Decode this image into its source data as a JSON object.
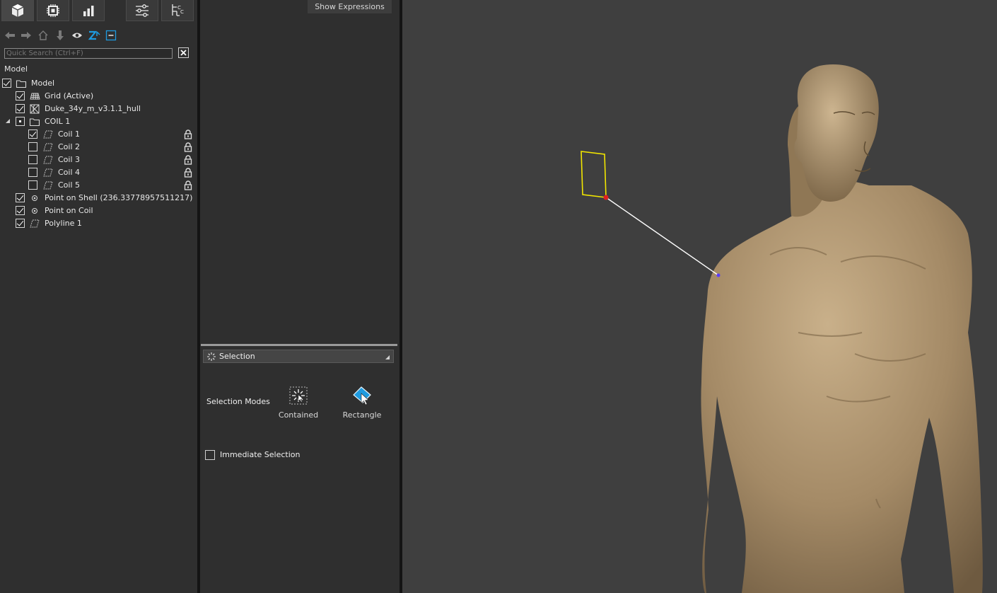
{
  "toolbar": {
    "tabs": [
      {
        "icon": "model-cube-icon",
        "active": true
      },
      {
        "icon": "chip-icon",
        "active": false
      },
      {
        "icon": "bar-chart-icon",
        "active": false
      },
      {
        "icon": "sliders-icon",
        "active": false
      },
      {
        "icon": "hierarchy-icon",
        "active": false
      }
    ],
    "tools": [
      "back-arrow-icon",
      "forward-arrow-icon",
      "home-icon",
      "down-arrow-icon",
      "eye-icon",
      "z-sort-icon",
      "collapse-icon"
    ]
  },
  "search": {
    "placeholder": "Quick Search (Ctrl+F)",
    "value": ""
  },
  "tree": {
    "header": "Model",
    "items": [
      {
        "label": "Model",
        "checked": true,
        "icon": "folder-icon",
        "level": 0
      },
      {
        "label": "Grid (Active)",
        "checked": true,
        "icon": "grid-icon",
        "level": 1
      },
      {
        "label": "Duke_34y_m_v3.1.1_hull",
        "checked": true,
        "icon": "mesh-icon",
        "level": 1
      },
      {
        "label": "COIL 1",
        "checked": "partial",
        "icon": "folder-icon",
        "level": 1,
        "expanded": true
      },
      {
        "label": "Coil 1",
        "checked": true,
        "icon": "polyline-icon",
        "level": 2,
        "locked": true
      },
      {
        "label": "Coil 2",
        "checked": false,
        "icon": "polyline-icon",
        "level": 2,
        "locked": true
      },
      {
        "label": "Coil 3",
        "checked": false,
        "icon": "polyline-icon",
        "level": 2,
        "locked": true
      },
      {
        "label": "Coil 4",
        "checked": false,
        "icon": "polyline-icon",
        "level": 2,
        "locked": true
      },
      {
        "label": "Coil 5",
        "checked": false,
        "icon": "polyline-icon",
        "level": 2,
        "locked": true
      },
      {
        "label": "Point on Shell (236.33778957511217)",
        "checked": true,
        "icon": "point-icon",
        "level": 1
      },
      {
        "label": "Point on Coil",
        "checked": true,
        "icon": "point-icon",
        "level": 1
      },
      {
        "label": "Polyline 1",
        "checked": true,
        "icon": "polyline-icon",
        "level": 1
      }
    ]
  },
  "properties": {
    "show_expressions": "Show Expressions"
  },
  "selection": {
    "combo_label": "Selection",
    "modes_label": "Selection Modes",
    "modes": [
      {
        "label": "Contained",
        "icon": "contained-selection-icon"
      },
      {
        "label": "Rectangle",
        "icon": "rectangle-selection-icon"
      }
    ],
    "immediate_label": "Immediate Selection",
    "immediate_checked": false
  },
  "viewport": {
    "background": "#3f3f3f",
    "coil_color": "#f2e600",
    "line_color": "#ffffff",
    "body_color": "#a8906c"
  }
}
